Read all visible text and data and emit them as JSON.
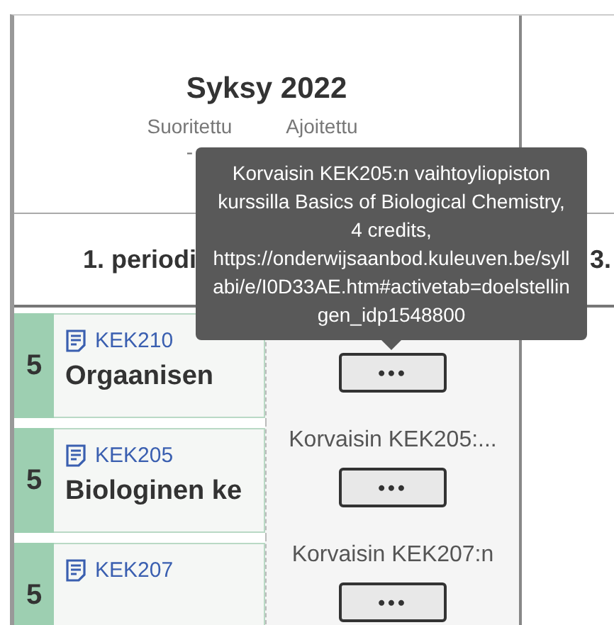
{
  "semester": {
    "title": "Syksy 2022",
    "stats": [
      {
        "label": "Suoritettu",
        "value": "-"
      },
      {
        "label": "Ajoitettu"
      }
    ]
  },
  "periods": [
    "1. periodi",
    "3."
  ],
  "courses": [
    {
      "credits": "5",
      "code": "KEK210",
      "name": "Orgaanisen",
      "button": "•••"
    },
    {
      "credits": "5",
      "code": "KEK205",
      "name": "Biologinen ke",
      "note": "Korvaisin KEK205:...",
      "button": "•••"
    },
    {
      "credits": "5",
      "code": "KEK207",
      "note": "Korvaisin KEK207:n",
      "button": "•••"
    }
  ],
  "tooltip": {
    "text": "Korvaisin KEK205:n vaihtoyliopiston kurssilla Basics of Biological Chemistry, 4 credits, https://onderwijsaanbod.kuleuven.be/syllabi/e/I0D33AE.htm#activetab=doelstellingen_idp1548800"
  }
}
